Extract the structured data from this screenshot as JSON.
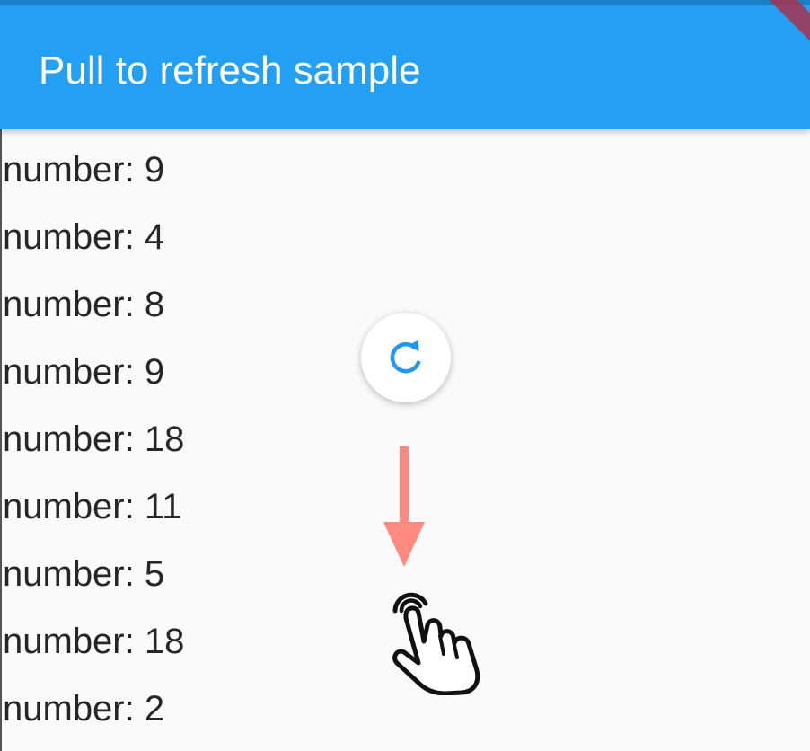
{
  "app": {
    "title": "Pull to refresh sample"
  },
  "list": {
    "items": [
      "number: 9",
      "number: 4",
      "number: 8",
      "number: 9",
      "number: 18",
      "number: 11",
      "number: 5",
      "number: 18",
      "number: 2"
    ]
  },
  "icons": {
    "refresh": "refresh-icon",
    "arrow": "arrow-down-icon",
    "hand": "pointing-hand-icon"
  },
  "colors": {
    "appbar": "#239ff3",
    "accent": "#2196f3",
    "arrow": "#ff8a80",
    "text": "#262626"
  }
}
